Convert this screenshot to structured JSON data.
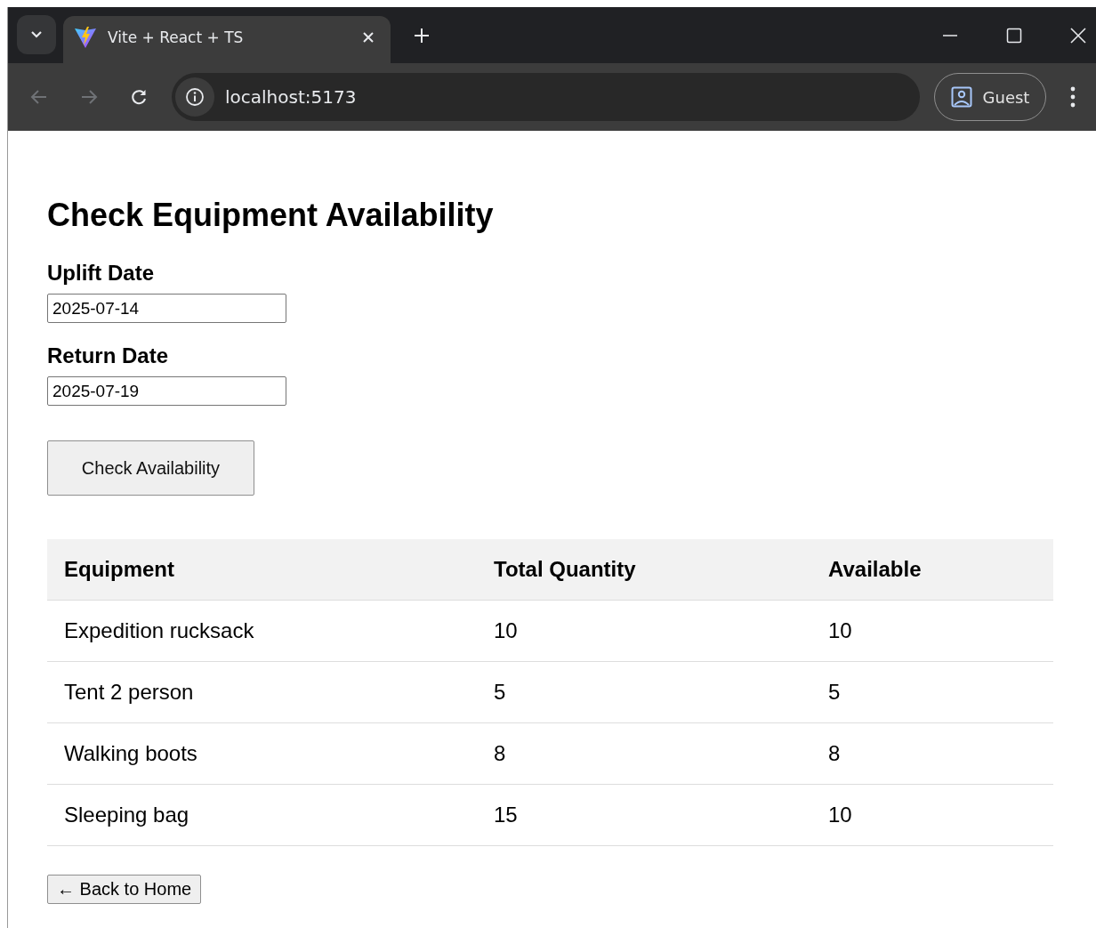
{
  "browser": {
    "tab": {
      "title": "Vite + React + TS",
      "selected": true
    },
    "address": "localhost:5173",
    "profile": "Guest"
  },
  "page": {
    "title": "Check Equipment Availability",
    "fields": [
      {
        "label": "Uplift Date",
        "value": "2025-07-14"
      },
      {
        "label": "Return Date",
        "value": "2025-07-19"
      }
    ],
    "check_button": "Check Availability",
    "table": {
      "columns": [
        "Equipment",
        "Total Quantity",
        "Available"
      ],
      "rows": [
        [
          "Expedition rucksack",
          "10",
          "10"
        ],
        [
          "Tent 2 person",
          "5",
          "5"
        ],
        [
          "Walking boots",
          "8",
          "8"
        ],
        [
          "Sleeping bag",
          "15",
          "10"
        ]
      ]
    },
    "back_button": "← Back to Home"
  }
}
